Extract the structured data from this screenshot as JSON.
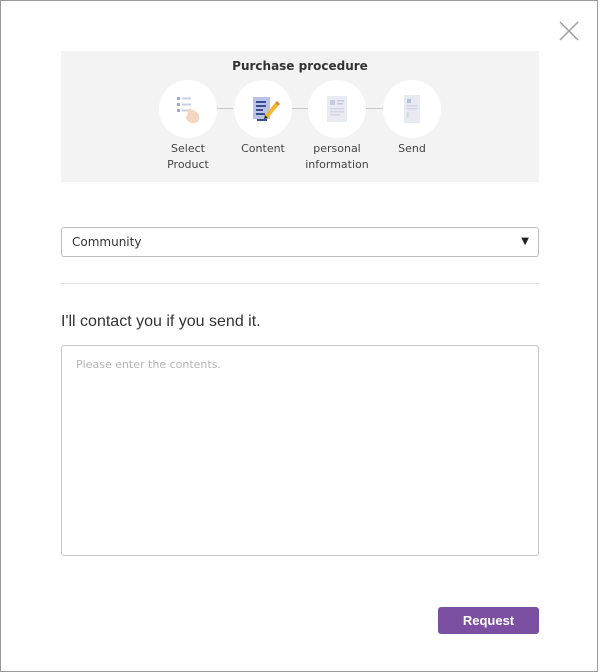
{
  "procedure": {
    "title": "Purchase procedure",
    "steps": [
      {
        "line1": "Select",
        "line2": "Product",
        "icon": "list-hand-icon"
      },
      {
        "line1": "Content",
        "line2": "",
        "icon": "document-pencil-icon"
      },
      {
        "line1": "personal",
        "line2": "information",
        "icon": "form-document-icon"
      },
      {
        "line1": "Send",
        "line2": "",
        "icon": "envelope-icon"
      }
    ]
  },
  "form": {
    "category_value": "Community",
    "heading": "I'll contact you if you send it.",
    "contents_placeholder": "Please enter the contents.",
    "request_label": "Request"
  },
  "colors": {
    "accent": "#7b4fa2",
    "procedure_bg": "#f3f3f3"
  }
}
